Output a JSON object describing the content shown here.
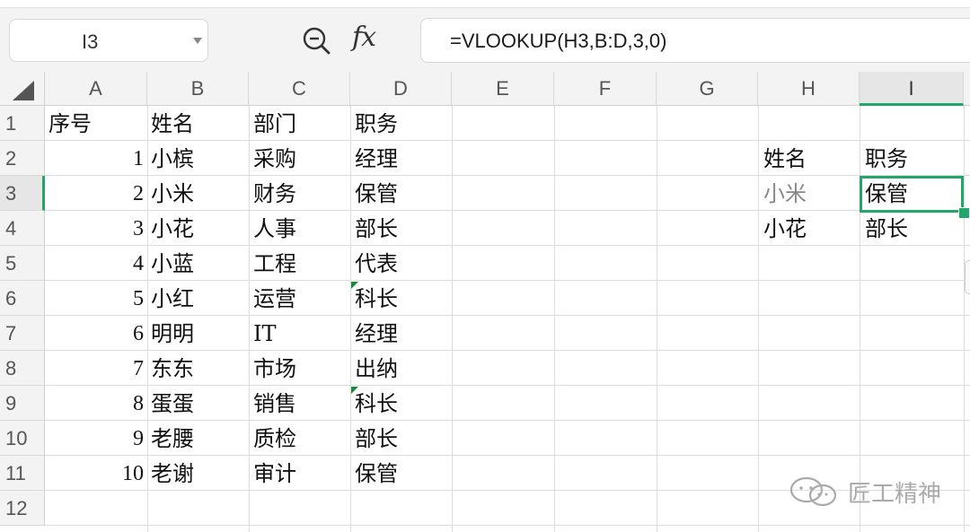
{
  "toolbar": {
    "name_box_value": "I3",
    "fx_label": "fx",
    "formula": "=VLOOKUP(H3,B:D,3,0)"
  },
  "columns": [
    "A",
    "B",
    "C",
    "D",
    "E",
    "F",
    "G",
    "H",
    "I"
  ],
  "rows": [
    "1",
    "2",
    "3",
    "4",
    "5",
    "6",
    "7",
    "8",
    "9",
    "10",
    "11",
    "12"
  ],
  "active_cell": {
    "column": "I",
    "row": "3"
  },
  "sheet": {
    "header": {
      "a": "序号",
      "b": "姓名",
      "c": "部门",
      "d": "职务"
    },
    "records": [
      {
        "a": "1",
        "b": "小槟",
        "c": "采购",
        "d": "经理"
      },
      {
        "a": "2",
        "b": "小米",
        "c": "财务",
        "d": "保管"
      },
      {
        "a": "3",
        "b": "小花",
        "c": "人事",
        "d": "部长"
      },
      {
        "a": "4",
        "b": "小蓝",
        "c": "工程",
        "d": "代表"
      },
      {
        "a": "5",
        "b": "小红",
        "c": "运营",
        "d": "科长"
      },
      {
        "a": "6",
        "b": "明明",
        "c": "IT",
        "d": "经理"
      },
      {
        "a": "7",
        "b": "东东",
        "c": "市场",
        "d": "出纳"
      },
      {
        "a": "8",
        "b": "蛋蛋",
        "c": "销售",
        "d": "科长"
      },
      {
        "a": "9",
        "b": "老腰",
        "c": "质检",
        "d": "部长"
      },
      {
        "a": "10",
        "b": "老谢",
        "c": "审计",
        "d": "保管"
      }
    ],
    "lookup": {
      "header_h": "姓名",
      "header_i": "职务",
      "rows": [
        {
          "h": "小米",
          "i": "保管"
        },
        {
          "h": "小花",
          "i": "部长"
        }
      ]
    }
  },
  "watermark": {
    "text": "匠工精神"
  },
  "colors": {
    "accent": "#22a66a",
    "header_bg": "#f3f3f3",
    "grid_line": "#dcdcdc"
  }
}
